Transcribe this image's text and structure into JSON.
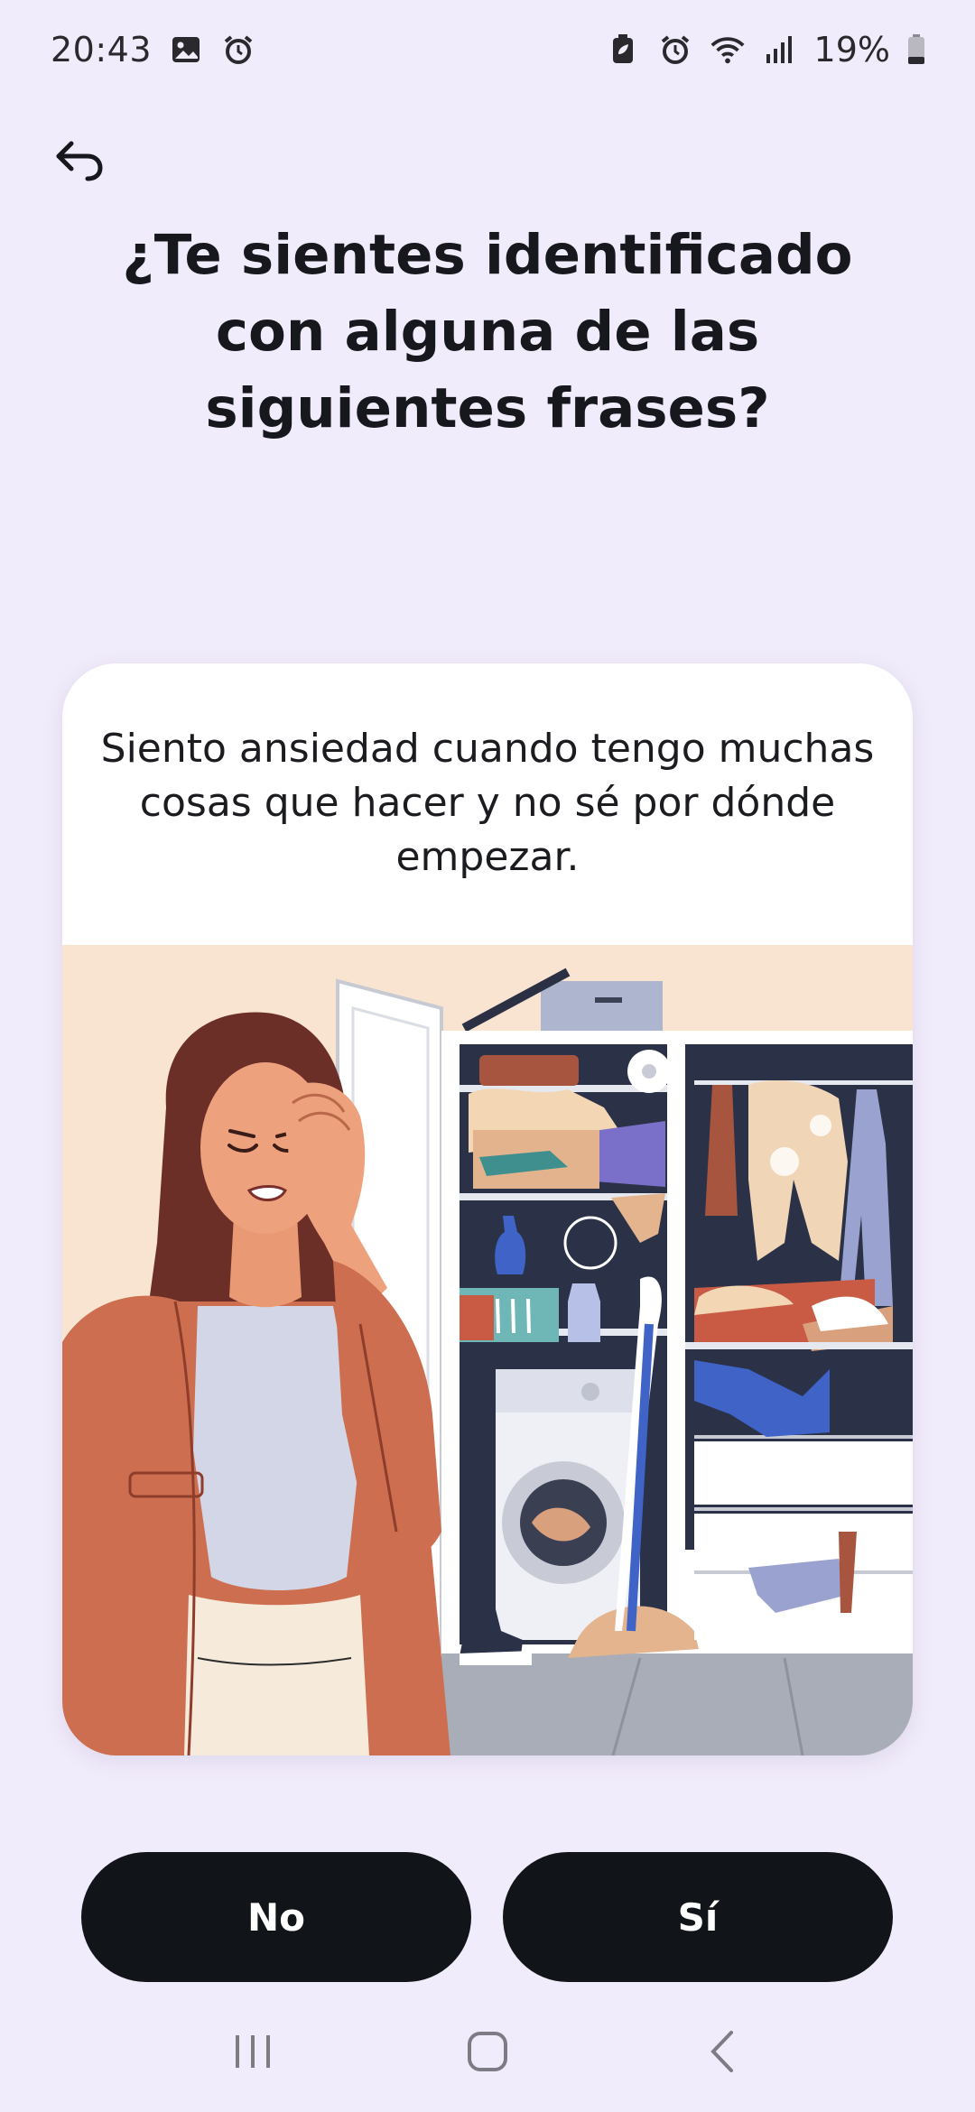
{
  "status_bar": {
    "time": "20:43",
    "battery_percent": "19%",
    "left_icons": [
      "gallery-icon",
      "alarm-icon"
    ],
    "right_icons": [
      "battery-saver-icon",
      "alarm-icon",
      "wifi-icon",
      "signal-icon",
      "battery-icon"
    ]
  },
  "header": {
    "back_icon": "back-arrow-icon",
    "title": "¿Te sientes identificado con alguna de las siguientes frases?"
  },
  "card": {
    "statement": "Siento ansiedad cuando tengo muchas cosas que hacer y no sé por dónde empezar.",
    "illustration": "woman-overwhelmed-by-messy-closet-illustration"
  },
  "actions": {
    "no_label": "No",
    "yes_label": "Sí"
  },
  "nav_bar": {
    "items": [
      "recent-apps-icon",
      "home-icon",
      "back-icon"
    ]
  },
  "colors": {
    "background": "#f1ecfb",
    "card": "#ffffff",
    "button": "#111418",
    "button_text": "#ffffff"
  }
}
